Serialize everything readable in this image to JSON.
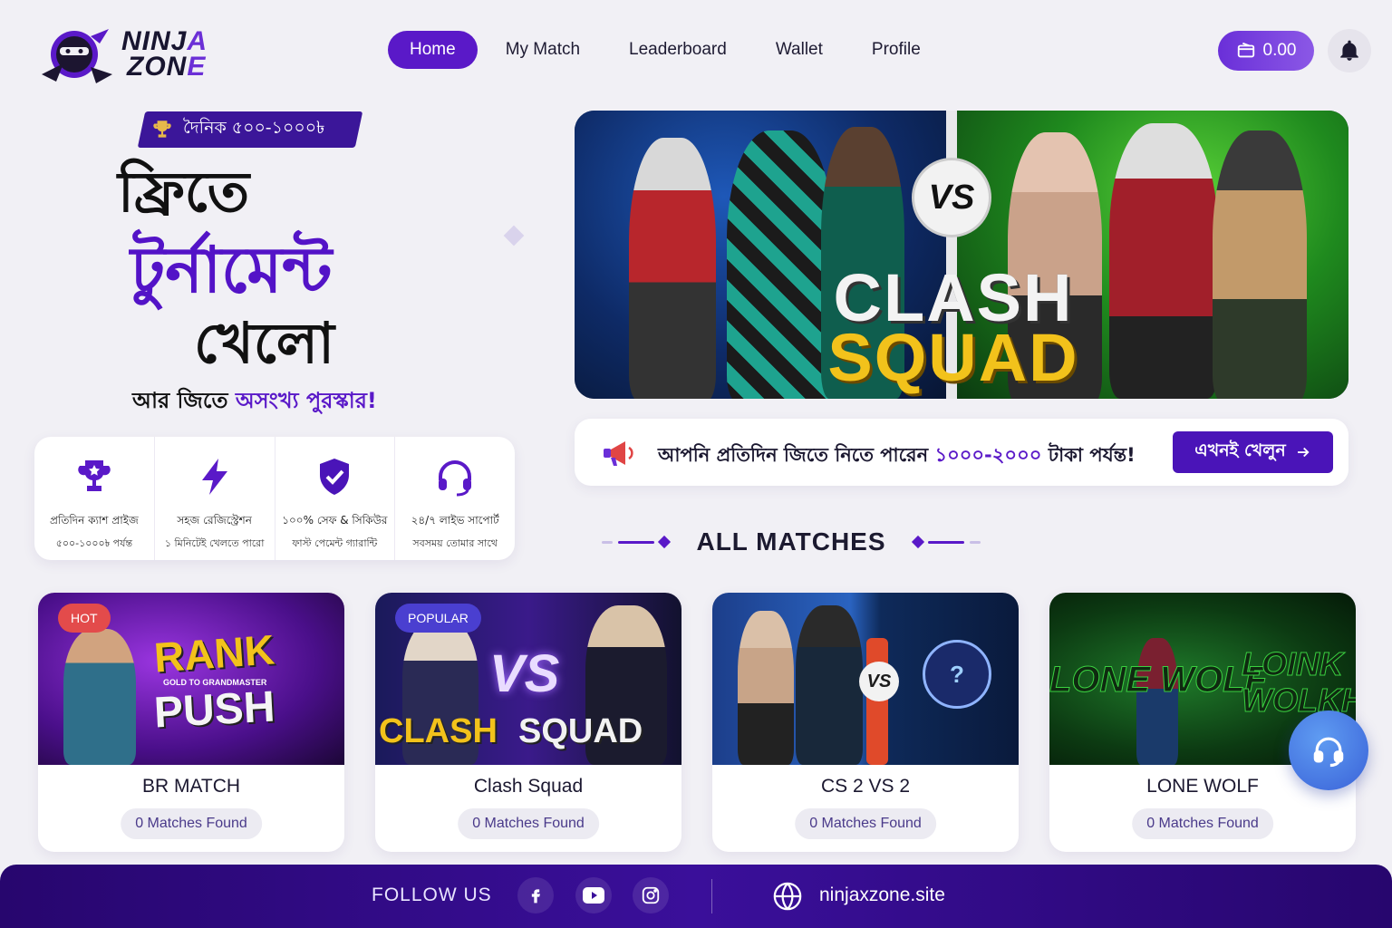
{
  "brand": {
    "logo_line1": "NINJ",
    "logo_line1_accent": "A",
    "logo_line2": "ZON",
    "logo_line2_accent": "E"
  },
  "nav": {
    "items": [
      {
        "label": "Home",
        "active": true
      },
      {
        "label": "My Match",
        "active": false
      },
      {
        "label": "Leaderboard",
        "active": false
      },
      {
        "label": "Wallet",
        "active": false
      },
      {
        "label": "Profile",
        "active": false
      }
    ]
  },
  "wallet": {
    "balance": "0.00",
    "icon": "taka-wallet-icon"
  },
  "notifications": {
    "icon": "bell-icon"
  },
  "hero": {
    "badge": "দৈনিক ৫০০-১০০০৳",
    "title_line1": "ফ্রিতে",
    "title_line2": "টুর্নামেন্ট",
    "title_line3": "খেলো",
    "subtitle_prefix": "আর জিতে ",
    "subtitle_accent": "অসংখ্য পুরস্কার!"
  },
  "features": [
    {
      "icon": "trophy-icon",
      "line1": "প্রতিদিন ক্যাশ প্রাইজ",
      "line2": "৫০০-১০০০৳ পর্যন্ত"
    },
    {
      "icon": "lightning-icon",
      "line1": "সহজ রেজিস্ট্রেশন",
      "line2": "১ মিনিটেই খেলতে পারো"
    },
    {
      "icon": "shield-check-icon",
      "line1": "১০০% সেফ & সিকিউর",
      "line2": "ফাস্ট পেমেন্ট গ্যারান্টি"
    },
    {
      "icon": "headset-icon",
      "line1": "২৪/৭ লাইভ সাপোর্ট",
      "line2": "সবসময় তোমার সাথে"
    }
  ],
  "banner": {
    "vs": "VS",
    "line1": "CLASH",
    "line2": "SQUAD"
  },
  "promo": {
    "text_prefix": "আপনি প্রতিদিন জিতে নিতে পারেন ",
    "text_accent": "১০০০-২০০০",
    "text_suffix": " টাকা পর্যন্ত!",
    "button": "এখনই খেলুন"
  },
  "section": {
    "title": "ALL MATCHES"
  },
  "matches": [
    {
      "title": "BR MATCH",
      "count": "0 Matches Found",
      "tag": "HOT",
      "art_line1": "RANK",
      "art_small": "GOLD TO GRANDMASTER",
      "art_line2": "PUSH"
    },
    {
      "title": "Clash Squad",
      "count": "0 Matches Found",
      "tag": "POPULAR",
      "art_vs": "VS",
      "art_left": "CLASH",
      "art_right": "SQUAD"
    },
    {
      "title": "CS 2 VS 2",
      "count": "0 Matches Found",
      "art_vs": "VS",
      "art_q": "?"
    },
    {
      "title": "LONE WOLF",
      "count": "0 Matches Found",
      "art_left": "LONE WOLF",
      "art_right_1": "LOINK",
      "art_right_2": "WOLKH"
    }
  ],
  "footer": {
    "follow": "FOLLOW US",
    "socials": [
      "facebook-icon",
      "youtube-icon",
      "instagram-icon"
    ],
    "site": "ninjaxzone.site"
  },
  "colors": {
    "primary": "#5a19c8",
    "dark": "#27066e",
    "hot": "#e34b4b",
    "popular": "#4a3fd0"
  }
}
